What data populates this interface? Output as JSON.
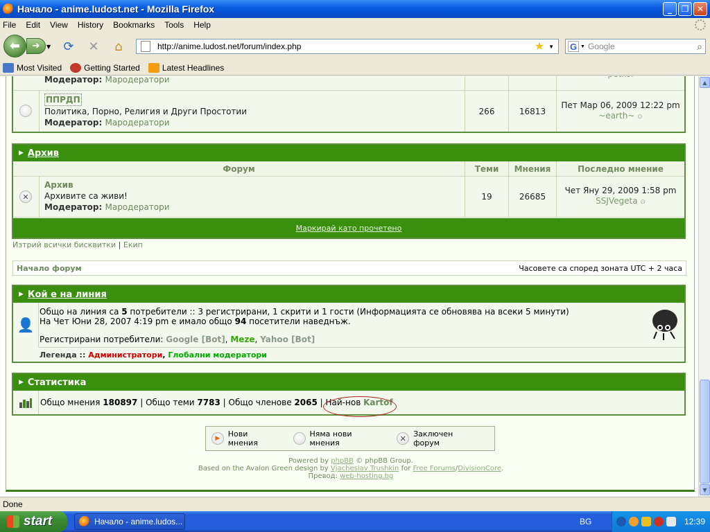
{
  "window": {
    "title": "Начало - anime.ludost.net - Mozilla Firefox"
  },
  "menu": [
    "File",
    "Edit",
    "View",
    "History",
    "Bookmarks",
    "Tools",
    "Help"
  ],
  "nav": {
    "url": "http://anime.ludost.net/forum/index.php",
    "search_placeholder": "Google"
  },
  "bookmarks": [
    "Most Visited",
    "Getting Started",
    "Latest Headlines"
  ],
  "forum": {
    "top_partial": {
      "moderator_label": "Модератор:",
      "moderator": "Мародератори",
      "last_user": "petkoi"
    },
    "pprdp": {
      "name": "ППРДП",
      "desc": "Политика, Порно, Религия и Други Простотии",
      "moderator_label": "Модератор:",
      "moderator": "Мародератори",
      "topics": "266",
      "posts": "16813",
      "last_date": "Пет Мар 06, 2009 12:22 pm",
      "last_user": "~earth~"
    },
    "archive_section": {
      "title": "Архив",
      "col_forum": "Форум",
      "col_topics": "Теми",
      "col_posts": "Мнения",
      "col_last": "Последно мнение"
    },
    "archive": {
      "name": "Архив",
      "desc": "Архивите са живи!",
      "moderator_label": "Модератор:",
      "moderator": "Мародератори",
      "topics": "19",
      "posts": "26685",
      "last_date": "Чет Яну 29, 2009 1:58 pm",
      "last_user": "SSJVegeta"
    },
    "mark_read": "Маркирай като прочетено",
    "delete_cookies": "Изтрий всички бисквитки",
    "team": "Екип",
    "breadcrumb_home": "Начало форум",
    "timezone": "Часовете са според зоната UTC + 2 часа"
  },
  "online": {
    "title": "Кой е на линия",
    "line1_pre": "Общо на линия са ",
    "line1_num": "5",
    "line1_post": " потребители :: 3 регистрирани, 1 скрити и 1 гости (Информацията се обновява на всеки 5 минути)",
    "line2_pre": "На Чет Юни 28, 2007 4:19 pm е имало общо ",
    "line2_num": "94",
    "line2_post": " посетители наведнъж.",
    "registered_label": "Регистрирани потребители:",
    "user1": "Google [Bot]",
    "user2": "Meze",
    "user3": "Yahoo [Bot]",
    "legend_label": "Легенда ::",
    "legend_admins": "Администратори",
    "legend_global": "Глобални модератори"
  },
  "stats": {
    "title": "Статистика",
    "total_posts_label": "Общо мнения",
    "total_posts": "180897",
    "total_topics_label": "Общо теми",
    "total_topics": "7783",
    "total_members_label": "Общо членове",
    "total_members": "2065",
    "newest_label": "Най-нов",
    "newest": "Kartof"
  },
  "legend_icons": {
    "new": "Нови мнения",
    "no_new": "Няма нови мнения",
    "locked": "Заключен форум"
  },
  "footer": {
    "powered_pre": "Powered by ",
    "phpbb": "phpBB",
    "powered_post": " © phpBB Group.",
    "design_pre": "Based on the Avalon Green design by ",
    "designer": "Vjacheslav Trushkin",
    "for": " for ",
    "free_forums": "Free Forums",
    "slash": "/",
    "divisioncore": "DivisionCore",
    "dot": ".",
    "translation_label": "Превод: ",
    "translator": "web-hosting.bg"
  },
  "status": "Done",
  "taskbar": {
    "start": "start",
    "item": "Начало - anime.ludos...",
    "lang": "BG",
    "clock": "12:39"
  },
  "colors": {
    "header_green": "#3b8f0e",
    "admin_red": "#cc0000",
    "global_mod_green": "#00aa00"
  }
}
